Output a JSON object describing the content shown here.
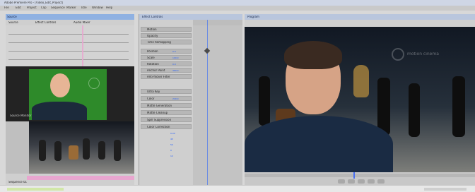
{
  "app": {
    "title": "Adobe Premiere Pro - [Video_Edit_Project]",
    "menu": [
      "File",
      "Edit",
      "Project",
      "Clip",
      "Sequence",
      "Marker",
      "Title",
      "Window",
      "Help"
    ]
  },
  "left_panel": {
    "header": "Source",
    "tabs": [
      "Source",
      "Effect Controls",
      "Audio Mixer"
    ],
    "monitor_label": "Source Monitor",
    "timeline_bottom_label": "Sequence 01"
  },
  "center_panel": {
    "header": "Effect Controls",
    "rows": [
      "Motion",
      "Opacity",
      "Time Remapping",
      "Position",
      "Scale",
      "Rotation",
      "Anchor Point",
      "Anti-flicker Filter",
      "Ultra Key",
      "Color",
      "Matte Generation",
      "Matte Cleanup",
      "Spill Suppression",
      "Color Correction"
    ],
    "values": [
      "0.0",
      "100.0",
      "0.0",
      "360.0",
      "240.0",
      "0.00",
      "45",
      "50",
      "0",
      "12"
    ]
  },
  "right_panel": {
    "header": "Program",
    "watermark": "motion cinema"
  },
  "colors": {
    "panel": "#c9c9c9",
    "dark": "#3a3a3a",
    "accent_pink": "#e9a6cf",
    "green": "#2e8a2a"
  }
}
